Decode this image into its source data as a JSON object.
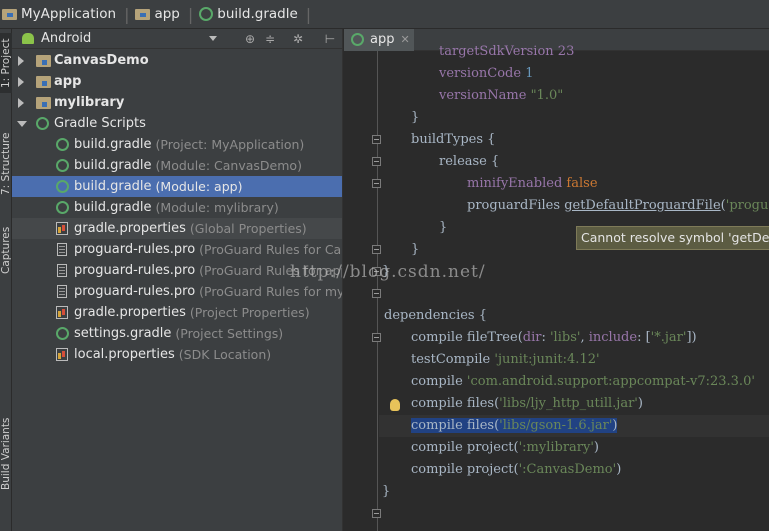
{
  "breadcrumb": {
    "items": [
      {
        "label": "MyApplication",
        "icon": "folder-icon"
      },
      {
        "label": "app",
        "icon": "module-folder-icon"
      },
      {
        "label": "build.gradle",
        "icon": "gradle-icon"
      }
    ]
  },
  "tool_stripe": {
    "project_tab": "1: Project",
    "structure_tab": "7: Structure",
    "captures_tab": "Captures",
    "build_variants_tab": "Build Variants"
  },
  "project_panel": {
    "view_mode": "Android",
    "tree": [
      {
        "label": "CanvasDemo",
        "hint": "",
        "icon": "module-folder-icon",
        "expanded": false,
        "bold": true
      },
      {
        "label": "app",
        "hint": "",
        "icon": "module-folder-icon",
        "expanded": false,
        "bold": true
      },
      {
        "label": "mylibrary",
        "hint": "",
        "icon": "module-folder-icon",
        "expanded": false,
        "bold": true
      },
      {
        "label": "Gradle Scripts",
        "hint": "",
        "icon": "gradle-icon",
        "expanded": true,
        "bold": false
      },
      {
        "label": "build.gradle",
        "hint": "(Project: MyApplication)",
        "icon": "gradle-icon"
      },
      {
        "label": "build.gradle",
        "hint": "(Module: CanvasDemo)",
        "icon": "gradle-icon"
      },
      {
        "label": "build.gradle",
        "hint": "(Module: app)",
        "icon": "gradle-icon",
        "selected": true
      },
      {
        "label": "build.gradle",
        "hint": "(Module: mylibrary)",
        "icon": "gradle-icon"
      },
      {
        "label": "gradle.properties",
        "hint": "(Global Properties)",
        "icon": "properties-icon"
      },
      {
        "label": "proguard-rules.pro",
        "hint": "(ProGuard Rules for Canva",
        "icon": "file-icon"
      },
      {
        "label": "proguard-rules.pro",
        "hint": "(ProGuard Rules for app)",
        "icon": "file-icon"
      },
      {
        "label": "proguard-rules.pro",
        "hint": "(ProGuard Rules for mylib",
        "icon": "file-icon"
      },
      {
        "label": "gradle.properties",
        "hint": "(Project Properties)",
        "icon": "properties-icon"
      },
      {
        "label": "settings.gradle",
        "hint": "(Project Settings)",
        "icon": "gradle-icon"
      },
      {
        "label": "local.properties",
        "hint": "(SDK Location)",
        "icon": "properties-icon"
      }
    ]
  },
  "editor": {
    "tab_label": "app",
    "tooltip": "Cannot resolve symbol 'getDefau",
    "watermark": "http://blog.csdn.net/",
    "code": {
      "l0_partial": "targetSdkVersion 23",
      "l1_prop": "versionCode",
      "l1_val": "1",
      "l2_prop": "versionName",
      "l2_val": "\"1.0\"",
      "l3": "}",
      "l4": "buildTypes {",
      "l5": "release {",
      "l6_prop": "minifyEnabled",
      "l6_val": "false",
      "l7_a": "proguardFiles ",
      "l7_b": "getDefaultProguardFile",
      "l7_c": "(",
      "l7_d": "'progu",
      "l8": "}",
      "l9": "}",
      "l10": "}",
      "l12": "dependencies {",
      "l13_a": "compile fileTree(",
      "l13_b": "dir",
      "l13_c": ": ",
      "l13_d": "'libs'",
      "l13_e": ", ",
      "l13_f": "include",
      "l13_g": ": [",
      "l13_h": "'*.jar'",
      "l13_i": "])",
      "l14_a": "testCompile ",
      "l14_b": "'junit:junit:4.12'",
      "l15_a": "compile ",
      "l15_b": "'com.android.support:appcompat-v7:23.3.0'",
      "l16_a": "compile files(",
      "l16_b": "'libs/ljy_http_utill.jar'",
      "l16_c": ")",
      "l17_a": "compile files(",
      "l17_b": "'libs/gson-1.6.jar'",
      "l17_c": ")",
      "l18_a": "compile project(",
      "l18_b": "':mylibrary'",
      "l18_c": ")",
      "l19_a": "compile project(",
      "l19_b": "':CanvasDemo'",
      "l19_c": ")",
      "l20": "}"
    }
  },
  "colors": {
    "selection": "#4b6eaf",
    "keyword": "#cc7832",
    "string": "#6a8759",
    "property": "#9876aa",
    "number": "#6897bb"
  }
}
